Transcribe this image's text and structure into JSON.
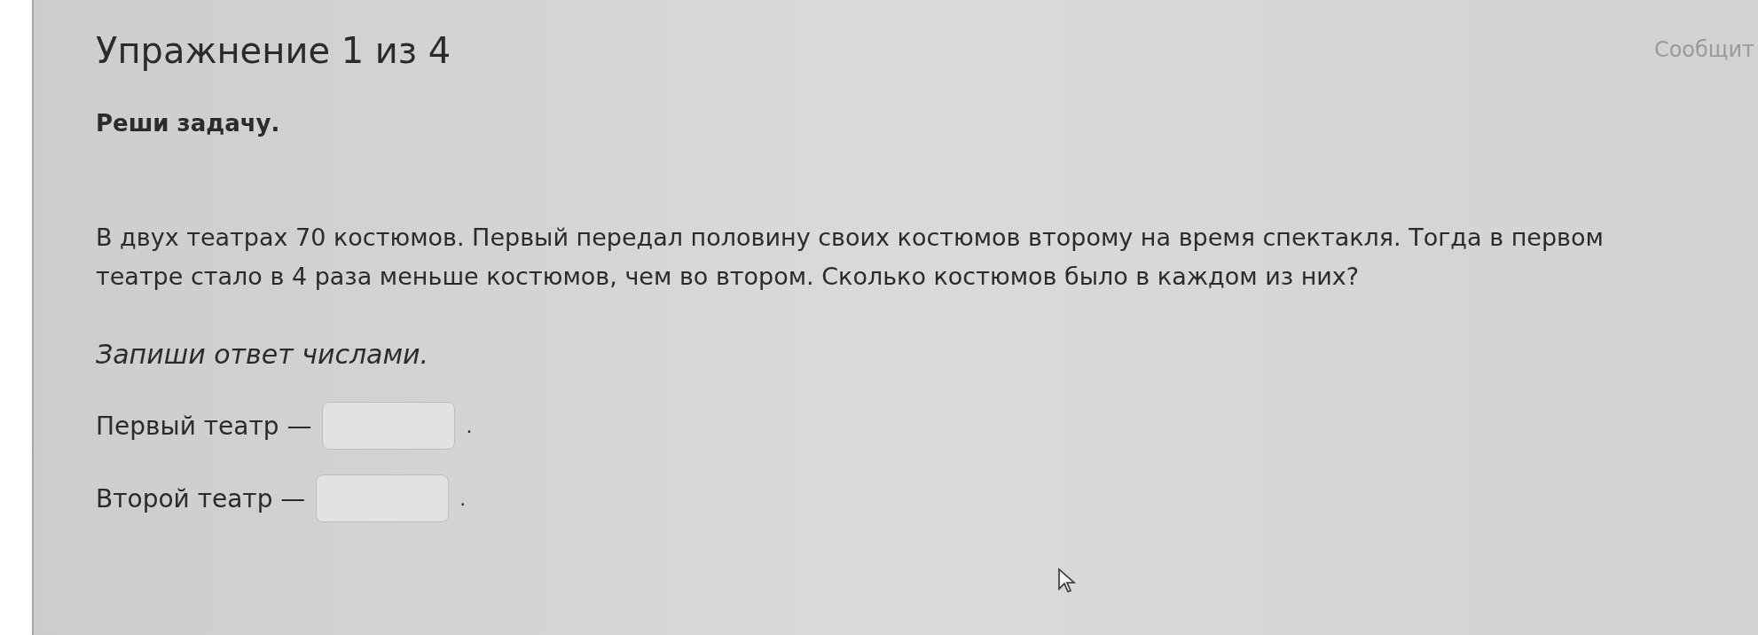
{
  "header": {
    "title": "Упражнение 1 из 4",
    "report_link": "Сообщит"
  },
  "instruction": "Реши задачу.",
  "problem": "В двух театрах 70 костюмов. Первый передал половину своих костюмов второму на время спектакля. Тогда в первом театре стало в 4 раза меньше костюмов, чем во втором. Сколько костюмов было в каждом из них?",
  "answer_hint": "Запиши ответ числами.",
  "answers": [
    {
      "label": "Первый театр —",
      "suffix": "."
    },
    {
      "label": "Второй театр —",
      "suffix": "."
    }
  ]
}
